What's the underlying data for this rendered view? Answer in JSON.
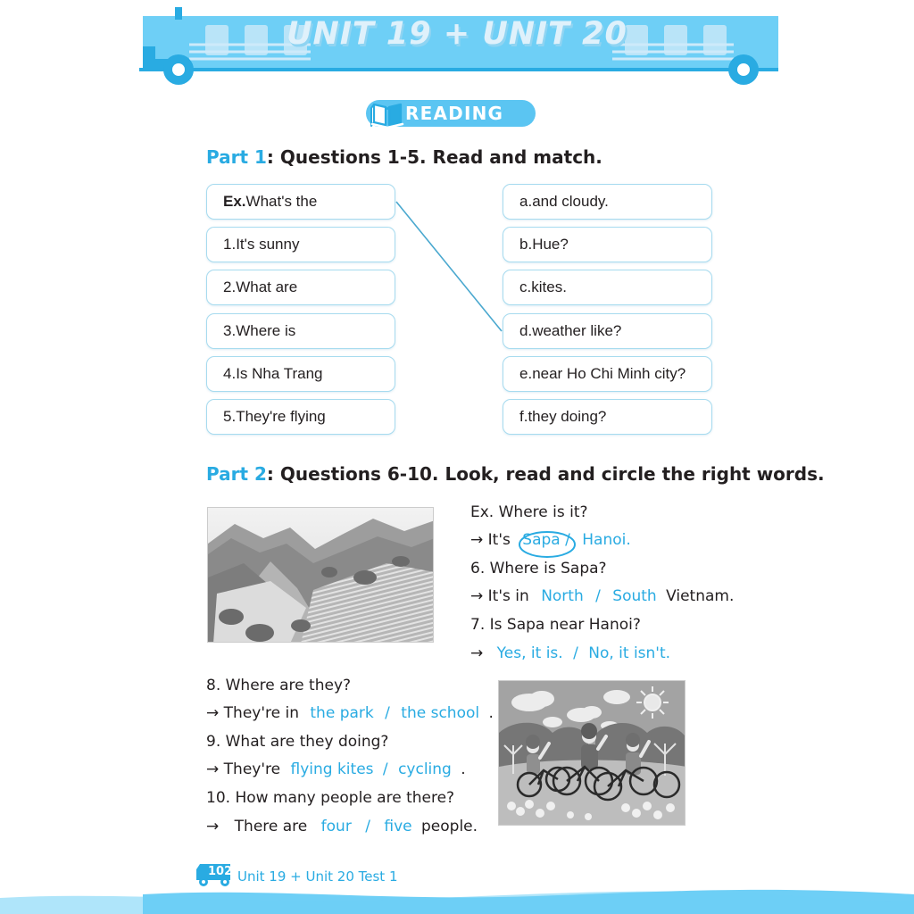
{
  "page": {
    "title": "UNIT 19 + UNIT 20",
    "section_badge": "READING",
    "book_icon": "open-book-icon",
    "footer_page_number": "102",
    "footer_label": "Unit 19 + Unit 20 Test 1"
  },
  "colors": {
    "accent_blue": "#29abe2",
    "light_blue": "#6ecff6",
    "pale_blue": "#a7dbef",
    "badge_blue": "#5bc5f2",
    "text_dark": "#231f20",
    "wave_blue": "#6ecff6"
  },
  "part1": {
    "key": "Part 1",
    "rest": ": Questions 1-5. Read and match.",
    "left_items": [
      {
        "prefix": "Ex.",
        "text": " What's the",
        "bold_prefix": true
      },
      {
        "prefix": "1.",
        "text": " It's sunny",
        "bold_prefix": false
      },
      {
        "prefix": "2.",
        "text": " What are",
        "bold_prefix": false
      },
      {
        "prefix": "3.",
        "text": " Where is",
        "bold_prefix": false
      },
      {
        "prefix": "4.",
        "text": " Is Nha Trang",
        "bold_prefix": false
      },
      {
        "prefix": "5.",
        "text": " They're flying",
        "bold_prefix": false
      }
    ],
    "right_items": [
      {
        "prefix": "a.",
        "text": " and cloudy."
      },
      {
        "prefix": "b.",
        "text": " Hue?"
      },
      {
        "prefix": "c.",
        "text": " kites."
      },
      {
        "prefix": "d.",
        "text": " weather like?"
      },
      {
        "prefix": "e.",
        "text": " near Ho Chi Minh city?"
      },
      {
        "prefix": "f.",
        "text": " they doing?"
      }
    ],
    "match_line": {
      "from": "Ex. What's the",
      "to": "d. weather like?"
    }
  },
  "part2": {
    "key": "Part 2",
    "rest": ": Questions 6-10. Look, read and circle the right words.",
    "photo_sapa_alt": "Sapa terraced rice fields photo",
    "photo_park_alt": "Children cycling in the park illustration",
    "circled_answer": "Sapa",
    "questions": [
      {
        "id": "ex",
        "question": "Ex. Where is it?",
        "answer_prefix": "It's",
        "option_a": "Sapa",
        "option_b": "Hanoi.",
        "sep": "/"
      },
      {
        "id": "q6",
        "question": "6. Where is Sapa?",
        "answer_prefix": "It's in",
        "option_a": "North",
        "option_b": "South",
        "answer_suffix": "Vietnam.",
        "sep": "/"
      },
      {
        "id": "q7",
        "question": "7. Is Sapa near Hanoi?",
        "answer_prefix": "",
        "option_a": "Yes, it is.",
        "option_b": "No, it isn't.",
        "sep": "/"
      },
      {
        "id": "q8",
        "question": "8. Where are they?",
        "answer_prefix": "They're in",
        "option_a": "the park",
        "option_b": "the school",
        "answer_suffix": ".",
        "sep": "/"
      },
      {
        "id": "q9",
        "question": "9. What are they doing?",
        "answer_prefix": "They're",
        "option_a": "flying kites",
        "option_b": "cycling",
        "answer_suffix": ".",
        "sep": "/"
      },
      {
        "id": "q10",
        "question": "10. How many people are there?",
        "answer_prefix": "There are",
        "option_a": "four",
        "option_b": "five",
        "answer_suffix": "people.",
        "sep": "/"
      }
    ]
  }
}
